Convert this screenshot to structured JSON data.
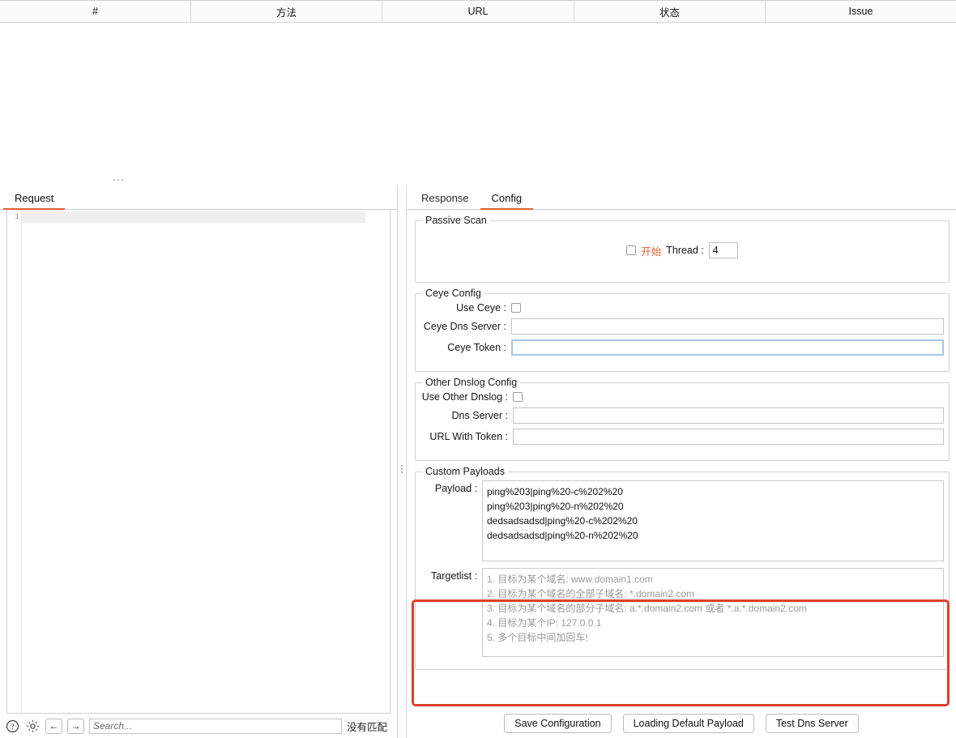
{
  "results_table": {
    "columns": [
      "#",
      "方法",
      "URL",
      "状态",
      "Issue"
    ],
    "rows": []
  },
  "left_pane": {
    "tabs": [
      {
        "label": "Request",
        "active": true
      }
    ],
    "editor": {
      "line_numbers": [
        "1"
      ],
      "content": ""
    },
    "bottom_bar": {
      "help_icon": "help-circle-icon",
      "settings_icon": "gear-icon",
      "prev_label": "←",
      "next_label": "→",
      "search_placeholder": "Search...",
      "search_value": "",
      "match_status": "没有匹配"
    }
  },
  "right_pane": {
    "tabs": [
      {
        "label": "Response",
        "active": false
      },
      {
        "label": "Config",
        "active": true
      }
    ],
    "passive_scan": {
      "legend": "Passive Scan",
      "start_label": "开始",
      "start_checked": false,
      "thread_label": "Thread :",
      "thread_value": "4"
    },
    "ceye_config": {
      "legend": "Ceye Config",
      "use_ceye_label": "Use Ceye :",
      "use_ceye_checked": false,
      "dns_server_label": "Ceye Dns Server :",
      "dns_server_value": "",
      "token_label": "Ceye Token :",
      "token_value": "",
      "token_focused": true
    },
    "other_dnslog_config": {
      "legend": "Other Dnslog Config",
      "use_other_label": "Use Other Dnslog :",
      "use_other_checked": false,
      "dns_server_label": "Dns Server :",
      "dns_server_value": "",
      "url_with_token_label": "URL With Token :",
      "url_with_token_value": ""
    },
    "custom_payloads": {
      "legend": "Custom Payloads",
      "payload_label": "Payload :",
      "payload_value": "ping%203|ping%20-c%202%20\nping%203|ping%20-n%202%20\ndedsadsadsd|ping%20-c%202%20\ndedsadsadsd|ping%20-n%202%20",
      "targetlist_label": "Targetlist :",
      "targetlist_value": "",
      "targetlist_placeholder": "1. 目标为某个域名: www.domain1.com\n2. 目标为某个域名的全部子域名: *.domain2.com\n3. 目标为某个域名的部分子域名: a.*.domain2.com 或者 *.a.*.domain2.com\n4. 目标为某个IP: 127.0.0.1\n5. 多个目标中间加回车!"
    },
    "actions": {
      "save_label": "Save Configuration",
      "loading_label": "Loading Default Payload",
      "test_label": "Test Dns Server"
    }
  },
  "annotation": {
    "highlight_color": "#e0402a"
  }
}
